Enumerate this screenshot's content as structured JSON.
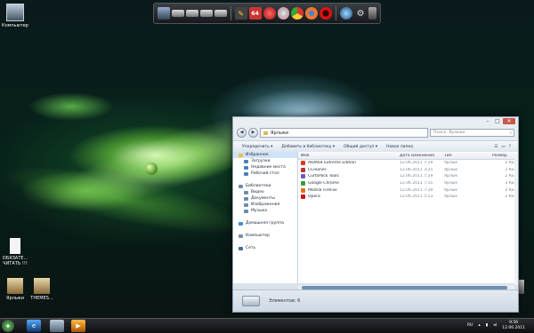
{
  "desktop": {
    "icons": [
      {
        "name": "computer-desktop-icon",
        "label": "Компьютер"
      },
      {
        "name": "readme-desktop-icon",
        "label": "ОБЯЗАТЕ... ЧИТАТЬ !!!"
      },
      {
        "name": "shortcuts-desktop-icon",
        "label": "Ярлыки"
      },
      {
        "name": "themes-desktop-icon",
        "label": "THEMES..."
      }
    ]
  },
  "dock": {
    "icons": [
      "monitor-icon",
      "drive-icon",
      "drive-icon",
      "drive-icon",
      "drive-icon",
      "aida64-icon",
      "ccleaner-icon",
      "cd-icon",
      "chrome-icon",
      "firefox-icon",
      "opera-icon",
      "network-icon",
      "settings-icon",
      "trash-icon"
    ],
    "aida_label": "64"
  },
  "window": {
    "address": "Ярлыки",
    "search_placeholder": "Поиск: Ярлыки",
    "toolbar": [
      "Упорядочить ▾",
      "Добавить в библиотеку ▾",
      "Общий доступ ▾",
      "Новая папка"
    ],
    "nav": [
      {
        "label": "Избранное",
        "group": true,
        "selected": true,
        "color": "#f0c040"
      },
      {
        "label": "Загрузки",
        "group": false,
        "color": "#4a7fc0"
      },
      {
        "label": "Недавние места",
        "group": false,
        "color": "#4a7fc0"
      },
      {
        "label": "Рабочий стол",
        "group": false,
        "color": "#4a7fc0"
      },
      {
        "label": "",
        "group": false,
        "color": ""
      },
      {
        "label": "Библиотеки",
        "group": true,
        "color": "#6a8cb0"
      },
      {
        "label": "Видео",
        "group": false,
        "color": "#6a8cb0"
      },
      {
        "label": "Документы",
        "group": false,
        "color": "#6a8cb0"
      },
      {
        "label": "Изображения",
        "group": false,
        "color": "#6a8cb0"
      },
      {
        "label": "Музыка",
        "group": false,
        "color": "#6a8cb0"
      },
      {
        "label": "",
        "group": false,
        "color": ""
      },
      {
        "label": "Домашняя группа",
        "group": true,
        "color": "#3f8fd0"
      },
      {
        "label": "",
        "group": false,
        "color": ""
      },
      {
        "label": "Компьютер",
        "group": true,
        "color": "#7a8ea2"
      },
      {
        "label": "",
        "group": false,
        "color": ""
      },
      {
        "label": "Сеть",
        "group": true,
        "color": "#3f6fa0"
      }
    ],
    "columns": {
      "name": "Имя",
      "date": "Дата изменения",
      "type": "Тип",
      "size": "Размер"
    },
    "files": [
      {
        "name": "AIDA64 Extreme Edition",
        "date": "12.06.2011 7:29",
        "type": "Ярлык",
        "size": "2 КБ",
        "color": "#d04020"
      },
      {
        "name": "CCleaner",
        "date": "12.06.2011 3:25",
        "type": "Ярлык",
        "size": "2 КБ",
        "color": "#c03030"
      },
      {
        "name": "CurtsPack Tools",
        "date": "12.06.2011 7:29",
        "type": "Ярлык",
        "size": "2 КБ",
        "color": "#6a5acd"
      },
      {
        "name": "Google Chrome",
        "date": "12.06.2011 7:55",
        "type": "Ярлык",
        "size": "3 КБ",
        "color": "#3a9a3a"
      },
      {
        "name": "Mozilla FireFox",
        "date": "12.06.2011 7:39",
        "type": "Ярлык",
        "size": "2 КБ",
        "color": "#e07020"
      },
      {
        "name": "Opera",
        "date": "12.06.2011 5:53",
        "type": "Ярлык",
        "size": "2 КБ",
        "color": "#cc1111"
      }
    ],
    "details": "Элементов: 6"
  },
  "taskbar": {
    "apps": [
      "ie-icon",
      "explorer-icon",
      "media-player-icon"
    ],
    "lang": "RU",
    "time": "9:56",
    "date": "12.06.2011"
  }
}
